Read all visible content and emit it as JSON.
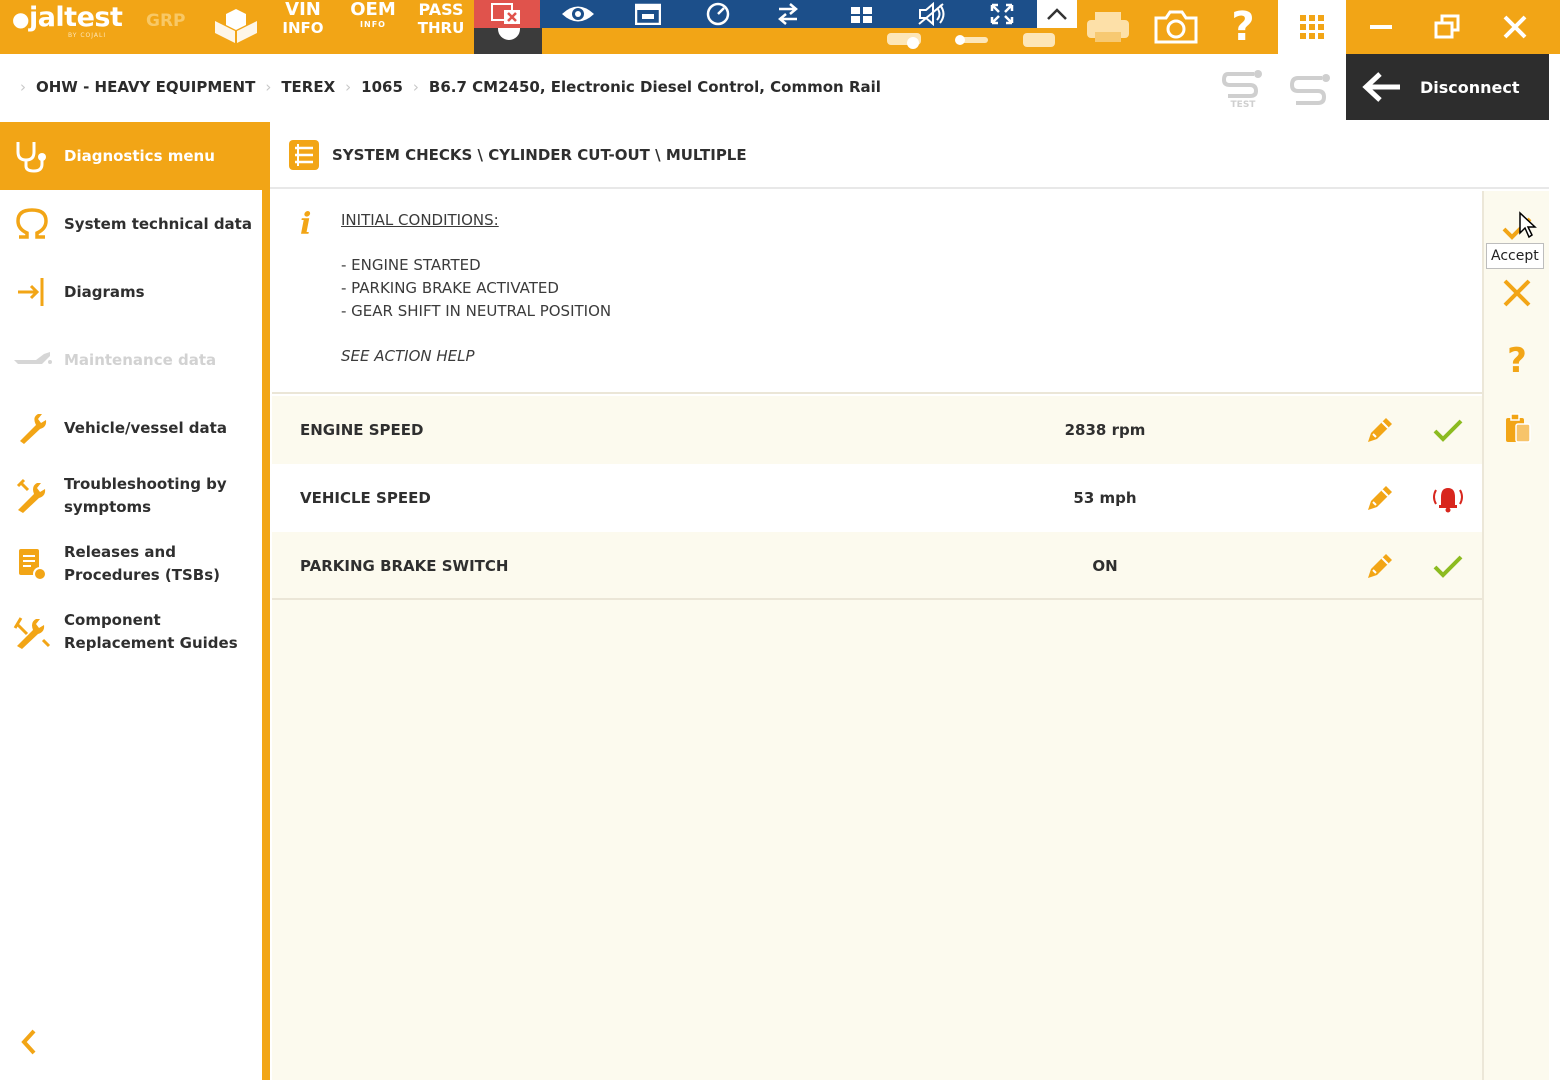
{
  "colors": {
    "accent": "#f2a516",
    "remote_bar": "#1c4f8a",
    "remote_close": "#e0534c",
    "dark": "#2d2d2d",
    "ok_green": "#8cbb20",
    "alert_red": "#d8261d"
  },
  "toolbar": {
    "logo": "jaltest",
    "logo_sub": "BY COJALI",
    "grp_label": "GRP",
    "vin_line1": "VIN",
    "vin_line2": "INFO",
    "oem_line1": "OEM",
    "oem_line2": "INFO",
    "pass_line1": "PASS",
    "pass_line2": "THRU",
    "icons": [
      "package-icon",
      "eye-icon",
      "window-icon",
      "gauge-icon",
      "transfer-icon",
      "keyboard-icon",
      "mute-icon",
      "expand-icon",
      "chevron-up-icon",
      "printer-icon",
      "camera-icon",
      "help-icon",
      "app-grid-icon",
      "minimize-icon",
      "restore-icon",
      "close-icon"
    ]
  },
  "breadcrumb": {
    "items": [
      "OHW - HEAVY EQUIPMENT",
      "TEREX",
      "1065",
      "B6.7 CM2450, Electronic Diesel Control, Common Rail"
    ],
    "test_tool_label": "TEST",
    "disconnect_label": "Disconnect"
  },
  "sidebar": {
    "header": "Diagnostics menu",
    "items": [
      {
        "label": "System technical data",
        "icon": "omega-icon",
        "enabled": true
      },
      {
        "label": "Diagrams",
        "icon": "diagram-icon",
        "enabled": true
      },
      {
        "label": "Maintenance data",
        "icon": "oil-can-icon",
        "enabled": false
      },
      {
        "label": "Vehicle/vessel data",
        "icon": "wrench-icon",
        "enabled": true
      },
      {
        "label": "Troubleshooting by symptoms",
        "icon": "tools-icon",
        "enabled": true
      },
      {
        "label": "Releases and Procedures (TSBs)",
        "icon": "document-icon",
        "enabled": true
      },
      {
        "label": "Component Replacement Guides",
        "icon": "replace-tools-icon",
        "enabled": true
      }
    ]
  },
  "main": {
    "title": "SYSTEM CHECKS \\ CYLINDER CUT-OUT \\ MULTIPLE",
    "conditions": {
      "heading": "INITIAL CONDITIONS:",
      "lines": [
        "- ENGINE STARTED",
        "- PARKING BRAKE ACTIVATED",
        "- GEAR SHIFT IN NEUTRAL POSITION"
      ],
      "help": "SEE ACTION HELP"
    },
    "parameters": [
      {
        "name": "ENGINE SPEED",
        "value": "2838 rpm",
        "status": "ok"
      },
      {
        "name": "VEHICLE SPEED",
        "value": "53 mph",
        "status": "alert"
      },
      {
        "name": "PARKING BRAKE SWITCH",
        "value": "ON",
        "status": "ok"
      }
    ]
  },
  "actions": {
    "tooltip": "Accept",
    "buttons": [
      "accept-button",
      "cancel-button",
      "help-button",
      "clipboard-button"
    ]
  }
}
